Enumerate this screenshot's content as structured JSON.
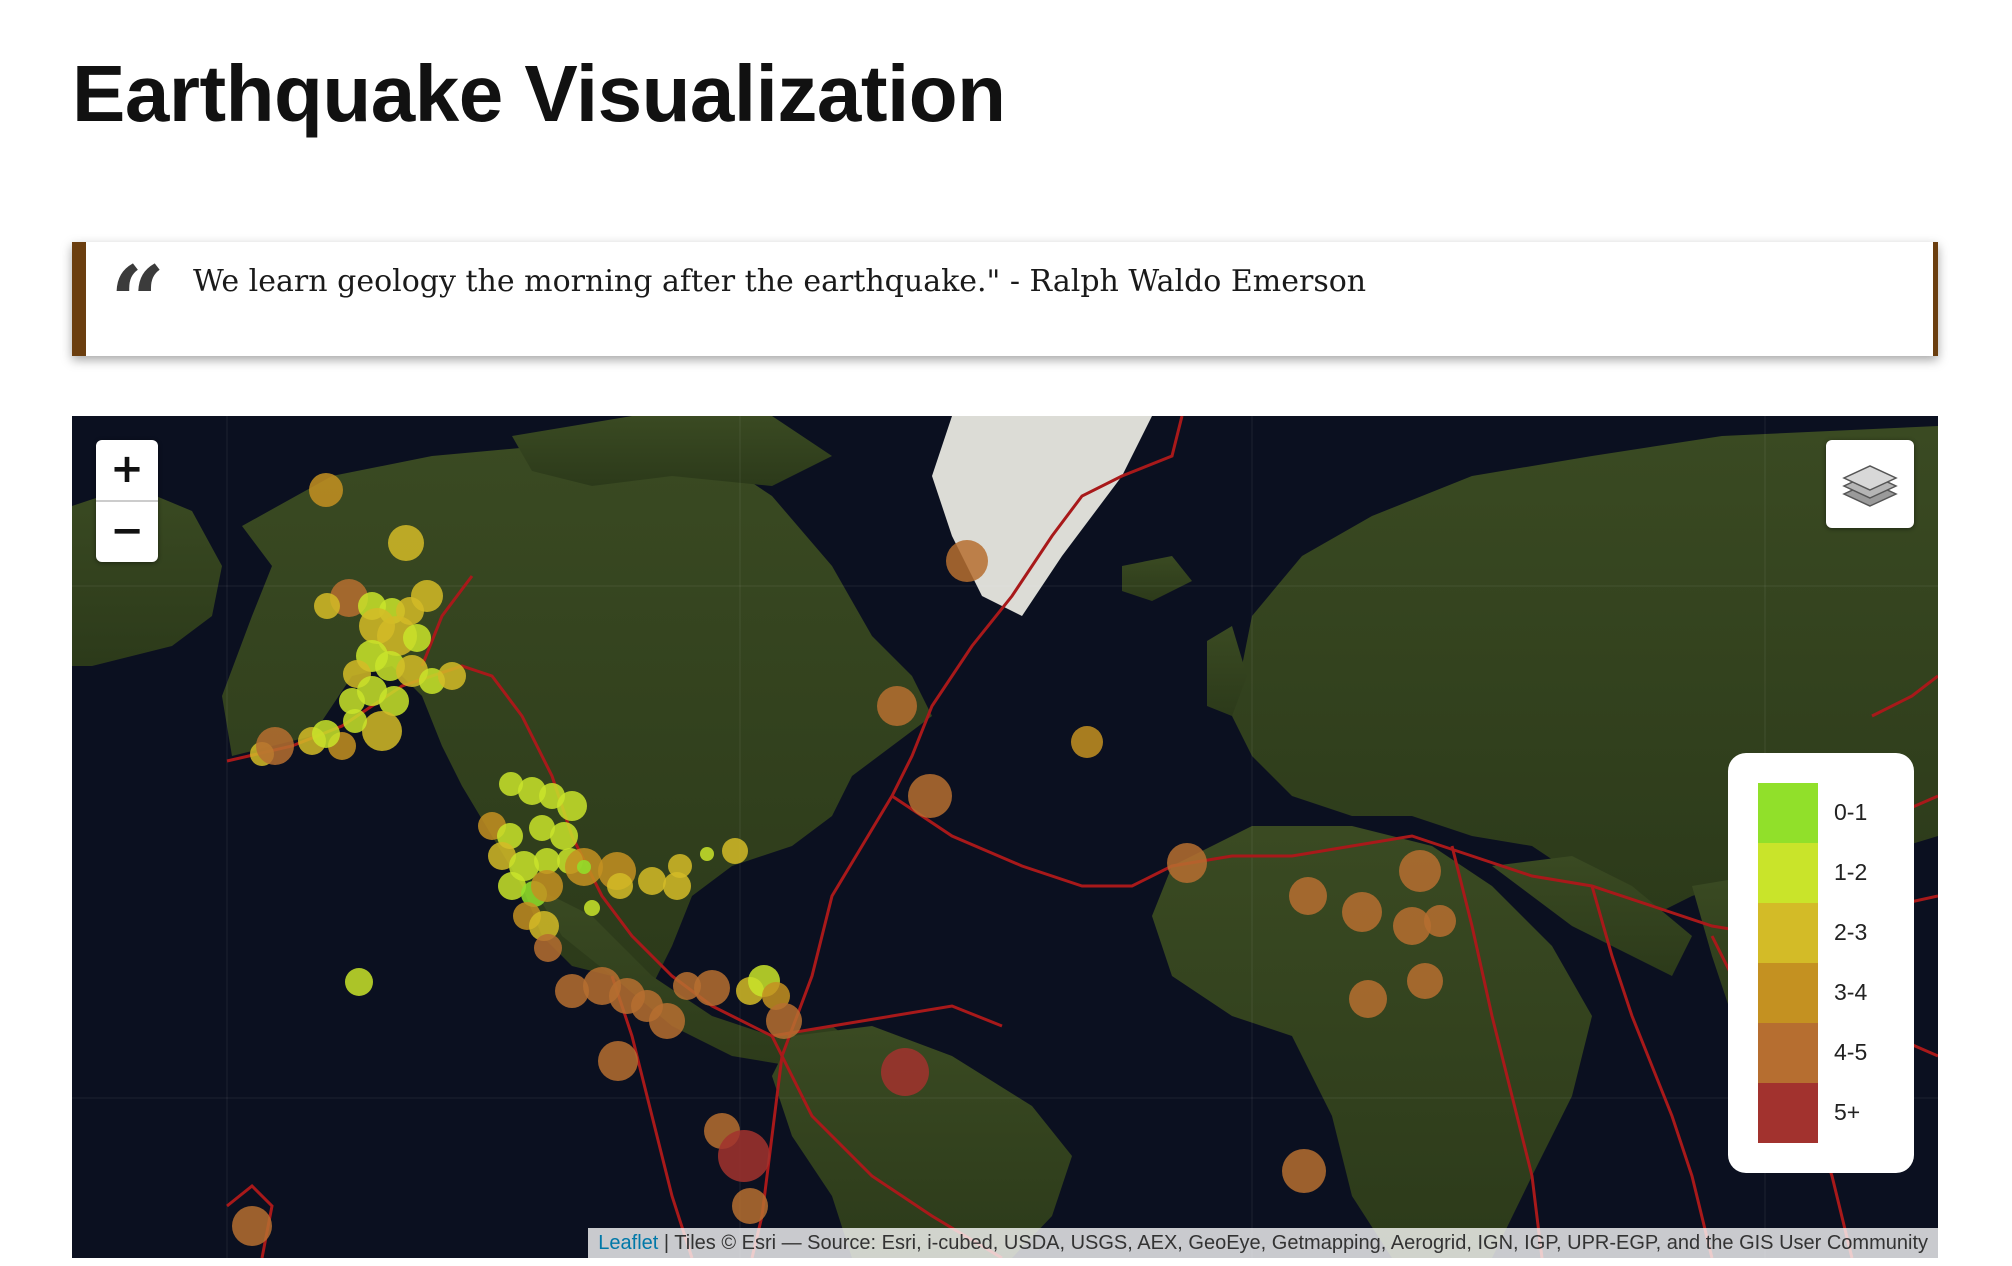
{
  "page": {
    "title": "Earthquake Visualization",
    "quote": "We learn geology the morning after the earthquake.\" - Ralph Waldo Emerson",
    "quote_mark": "“"
  },
  "map": {
    "zoom_in": "+",
    "zoom_out": "−",
    "layers_control_icon": "layers-icon",
    "attribution": {
      "leaflet": "Leaflet",
      "rest": " | Tiles © Esri — Source: Esri, i-cubed, USDA, USGS, AEX, GeoEye, Getmapping, Aerogrid, IGN, IGP, UPR-EGP, and the GIS User Community"
    },
    "colors": {
      "ocean": "#0b1020",
      "land": "#33421d",
      "ice": "#dcdcd6",
      "plates": "#a8191a"
    }
  },
  "legend": {
    "items": [
      {
        "label": "0-1",
        "color": "#91e02a"
      },
      {
        "label": "1-2",
        "color": "#c9e42a"
      },
      {
        "label": "2-3",
        "color": "#d3bb27"
      },
      {
        "label": "3-4",
        "color": "#c49121"
      },
      {
        "label": "4-5",
        "color": "#b66e30"
      },
      {
        "label": "5+",
        "color": "#a2322e"
      }
    ]
  }
}
